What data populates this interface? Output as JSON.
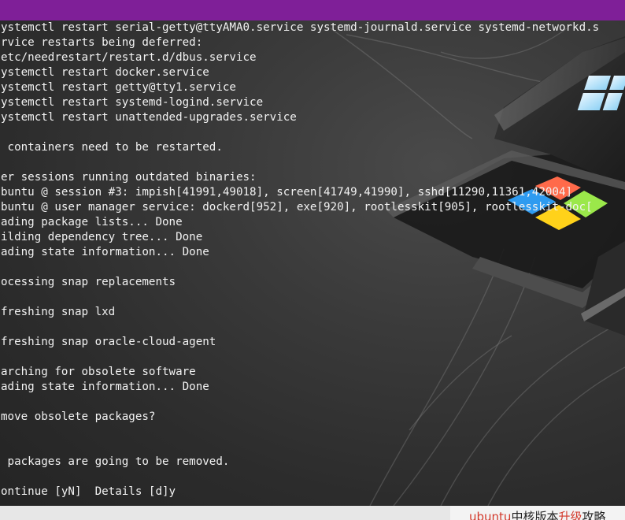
{
  "colors": {
    "titlebar": "#7f1f98",
    "terminal_text": "#f2f2f2",
    "highlight": "#d33a2c"
  },
  "terminal": {
    "lines": [
      "ystemctl restart serial-getty@ttyAMA0.service systemd-journald.service systemd-networkd.s",
      "rvice restarts being deferred:",
      "etc/needrestart/restart.d/dbus.service",
      "ystemctl restart docker.service",
      "ystemctl restart getty@tty1.service",
      "ystemctl restart systemd-logind.service",
      "ystemctl restart unattended-upgrades.service",
      "",
      " containers need to be restarted.",
      "",
      "er sessions running outdated binaries:",
      "buntu @ session #3: impish[41991,49018], screen[41749,41990], sshd[11290,11361,42004]",
      "buntu @ user manager service: dockerd[952], exe[920], rootlesskit[905], rootlesskit-doc[",
      "ading package lists... Done",
      "ilding dependency tree... Done",
      "ading state information... Done",
      "",
      "ocessing snap replacements",
      "",
      "freshing snap lxd",
      "",
      "freshing snap oracle-cloud-agent",
      "",
      "arching for obsolete software",
      "ading state information... Done",
      "",
      "move obsolete packages?",
      "",
      "",
      " packages are going to be removed.",
      "",
      "ontinue [yN]  Details [d]y"
    ]
  },
  "footer": {
    "link_part1": "ubuntu",
    "link_part2": "中核版本",
    "link_part3": "升级",
    "link_part4": "攻略"
  }
}
